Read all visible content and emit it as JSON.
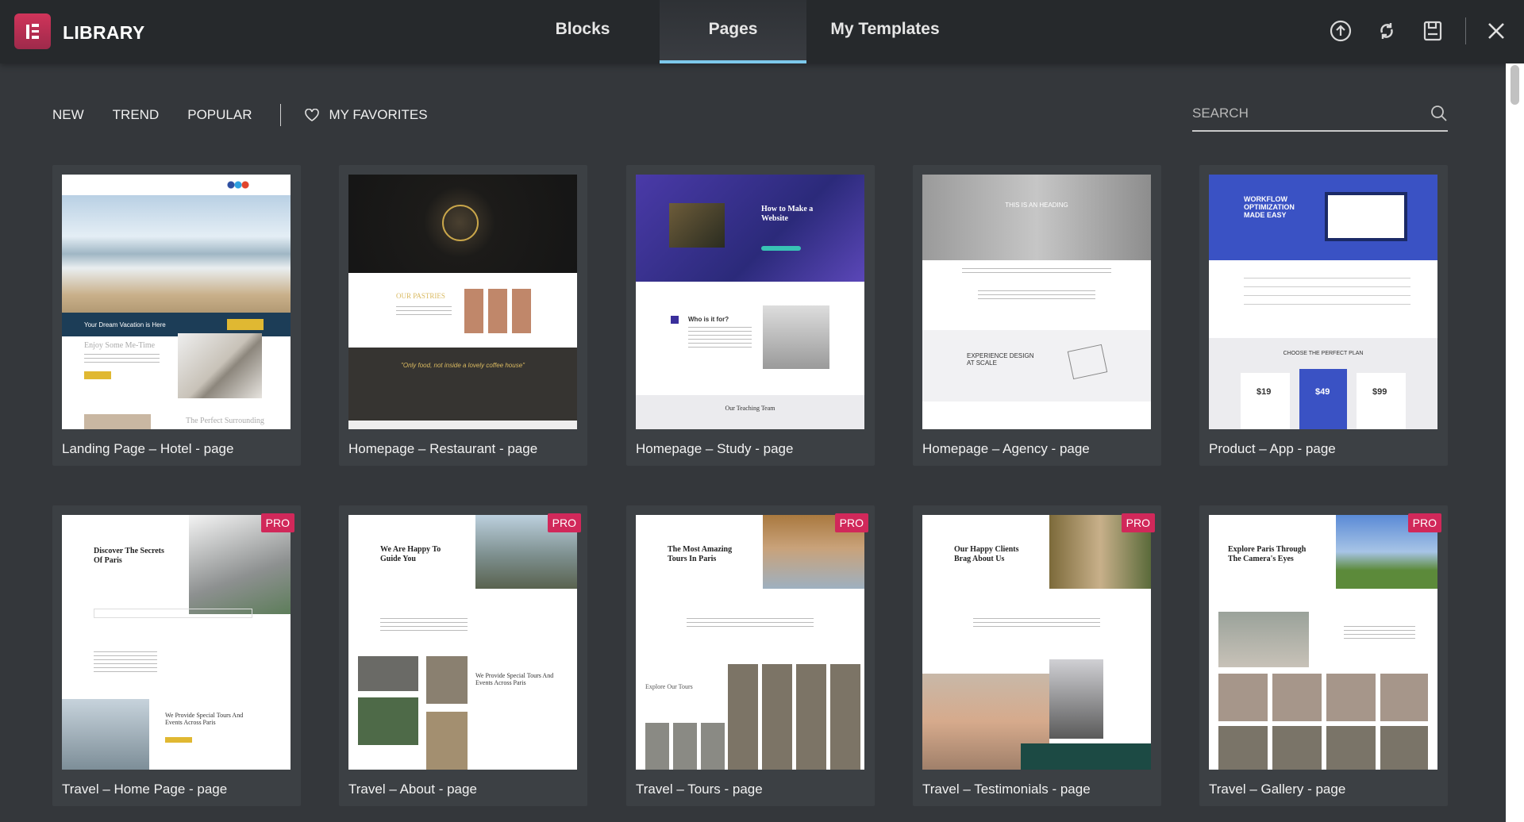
{
  "header": {
    "title": "LIBRARY",
    "tabs": [
      {
        "label": "Blocks"
      },
      {
        "label": "Pages",
        "active": true
      },
      {
        "label": "My Templates"
      }
    ],
    "icons": [
      "upload-icon",
      "sync-icon",
      "save-icon",
      "close-icon"
    ],
    "accent": "#7cc8ea",
    "logo_color": "#c0304f"
  },
  "filters": {
    "items": [
      "NEW",
      "TREND",
      "POPULAR"
    ],
    "favorites": "MY FAVORITES",
    "search_placeholder": "SEARCH"
  },
  "cards": [
    {
      "label": "Landing Page – Hotel - page",
      "pro": false,
      "thumb": {
        "banner": "Your Dream Vacation is Here",
        "heading": "Enjoy Some Me-Time",
        "heading2": "The Perfect Surrounding"
      }
    },
    {
      "label": "Homepage – Restaurant - page",
      "pro": false,
      "thumb": {
        "heading": "OUR PASTRIES",
        "quote": "\"Only food, not inside a lovely coffee house\""
      }
    },
    {
      "label": "Homepage – Study - page",
      "pro": false,
      "thumb": {
        "heading": "How to Make a Website",
        "sub": "Who is it for?",
        "team": "Our Teaching Team"
      }
    },
    {
      "label": "Homepage – Agency - page",
      "pro": false,
      "thumb": {
        "heading": "THIS IS AN HEADING",
        "sub": "EXPERIENCE DESIGN AT SCALE"
      }
    },
    {
      "label": "Product – App - page",
      "pro": false,
      "thumb": {
        "heading": "WORKFLOW OPTIMIZATION MADE EASY",
        "plans": "CHOOSE THE PERFECT PLAN",
        "prices": [
          "$19",
          "$49",
          "$99"
        ]
      }
    },
    {
      "label": "Travel – Home Page - page",
      "pro": true,
      "thumb": {
        "heading": "Discover The Secrets Of Paris",
        "sub": "We Provide Special Tours And Events Across Paris"
      }
    },
    {
      "label": "Travel – About - page",
      "pro": true,
      "thumb": {
        "heading": "We Are Happy To Guide You",
        "sub": "We Provide Special Tours And Events Across Paris"
      }
    },
    {
      "label": "Travel – Tours - page",
      "pro": true,
      "thumb": {
        "heading": "The Most Amazing Tours In Paris",
        "sub": "Explore Our Tours"
      }
    },
    {
      "label": "Travel – Testimonials - page",
      "pro": true,
      "thumb": {
        "heading": "Our Happy Clients Brag About Us"
      }
    },
    {
      "label": "Travel – Gallery - page",
      "pro": true,
      "thumb": {
        "heading": "Explore Paris Through The Camera's Eyes"
      }
    }
  ],
  "pro_label": "PRO",
  "colors": {
    "header_bg": "#26292c",
    "body_bg": "#34373b",
    "card_bg": "#3c4044",
    "pro_badge": "#d1285a"
  }
}
